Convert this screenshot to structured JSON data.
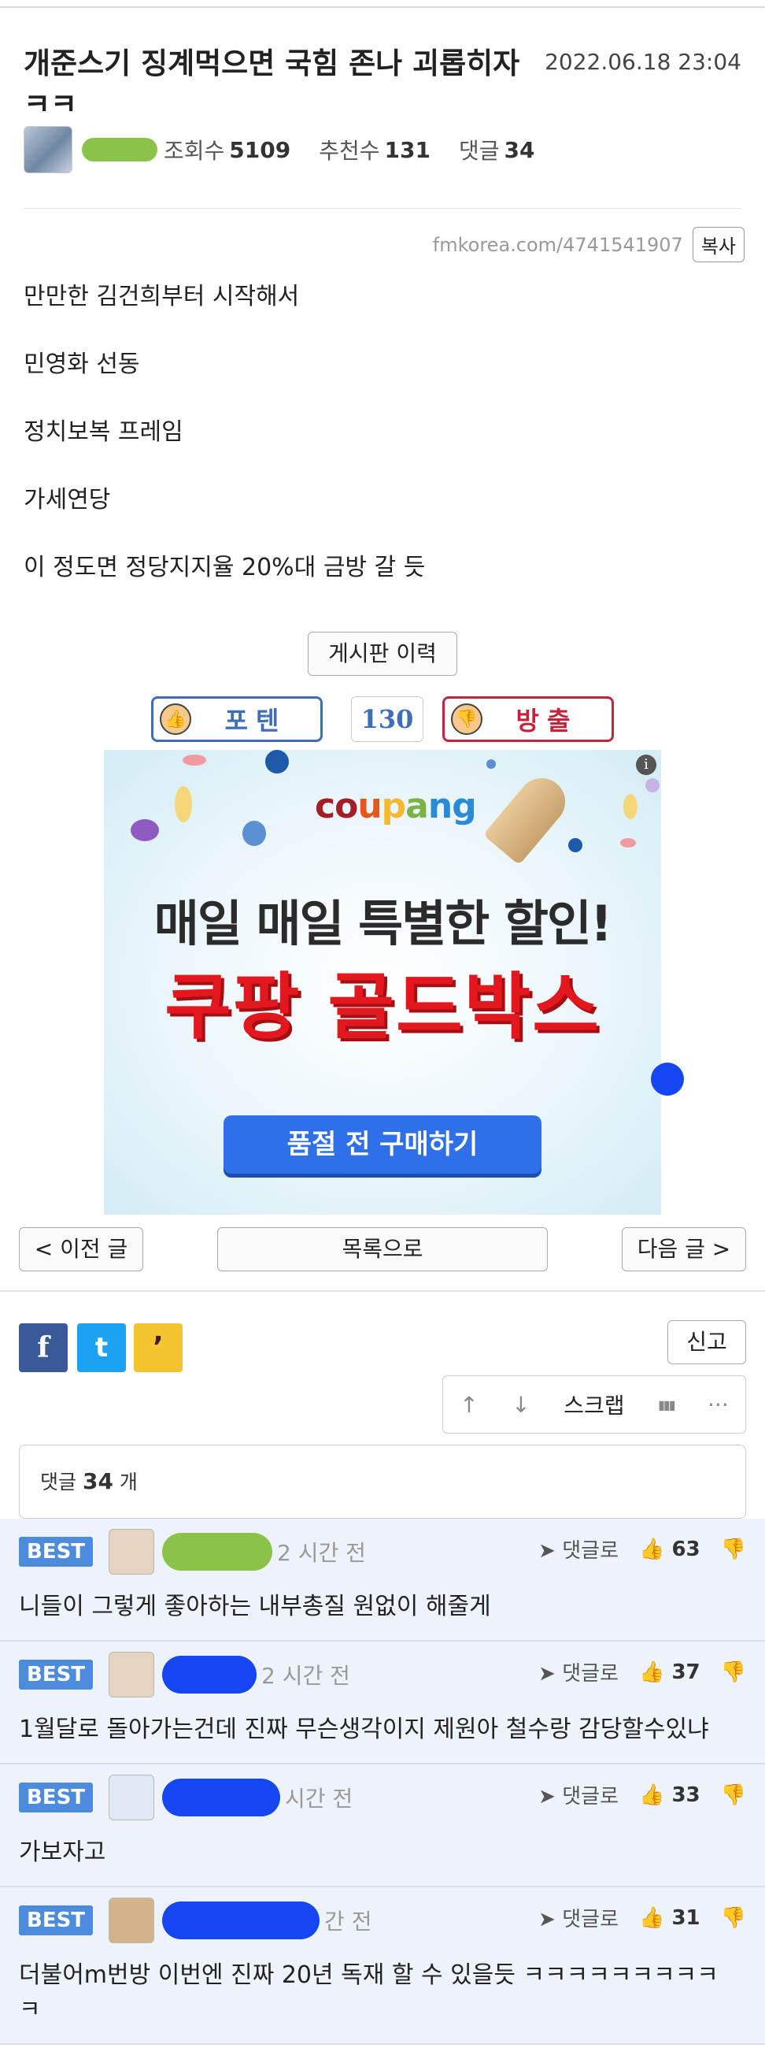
{
  "post": {
    "title": "개준스기 징계먹으면 국힘 존나 괴롭히자 ㅋㅋ",
    "date": "2022.06.18 23:04",
    "views_label": "조회수",
    "views": "5109",
    "recommend_label": "추천수",
    "recommend": "131",
    "comments_label": "댓글",
    "comments": "34",
    "url": "fmkorea.com/4741541907",
    "copy_label": "복사",
    "body": [
      "만만한 김건희부터 시작해서",
      "민영화 선동",
      "정치보복 프레임",
      "가세연당",
      "이 정도면 정당지지율 20%대 금방 갈 듯"
    ],
    "history_label": "게시판 이력"
  },
  "vote": {
    "up_label": "포텐",
    "count": "130",
    "down_label": "방출"
  },
  "ad": {
    "info": "i",
    "brand": [
      "c",
      "o",
      "u",
      "p",
      "a",
      "n",
      "g"
    ],
    "line1": "매일 매일 특별한 할인!",
    "line2": "쿠팡 골드박스",
    "cta": "품절 전 구매하기"
  },
  "nav": {
    "prev": "< 이전 글",
    "list": "목록으로",
    "next": "다음 글 >"
  },
  "share": {
    "fb": "f",
    "tw": "t",
    "kk": "’"
  },
  "report_label": "신고",
  "toolbar": {
    "up": "↑",
    "down": "↓",
    "scrap": "스크랩",
    "stats": "▮▮▮",
    "more": "···"
  },
  "comment_box": {
    "prefix": "댓글",
    "count": "34",
    "suffix": "개"
  },
  "comment_list": [
    {
      "badge": "BEST",
      "time": "2 시간 전",
      "reply": "댓글로",
      "likes": "63",
      "text": "니들이 그렇게 좋아하는 내부총질 원없이 해줄게"
    },
    {
      "badge": "BEST",
      "time": "2 시간 전",
      "reply": "댓글로",
      "likes": "37",
      "text": "1월달로 돌아가는건데 진짜 무슨생각이지 제원아 철수랑 감당할수있냐"
    },
    {
      "badge": "BEST",
      "time": "시간 전",
      "reply": "댓글로",
      "likes": "33",
      "text": "가보자고"
    },
    {
      "badge": "BEST",
      "time": "간 전",
      "reply": "댓글로",
      "likes": "31",
      "text": "더불어m번방 이번엔 진짜 20년 독재 할 수 있을듯 ㅋㅋㅋㅋㅋㅋㅋㅋㅋ ㅋ"
    }
  ],
  "colors": {
    "best_badge": "#4d8bdc",
    "comment_bg": "#eef3fb",
    "vote_up": "#3f6db8",
    "vote_down": "#c3243c",
    "coupang_red": "#e3181e",
    "cta_blue": "#2f6fe8"
  }
}
